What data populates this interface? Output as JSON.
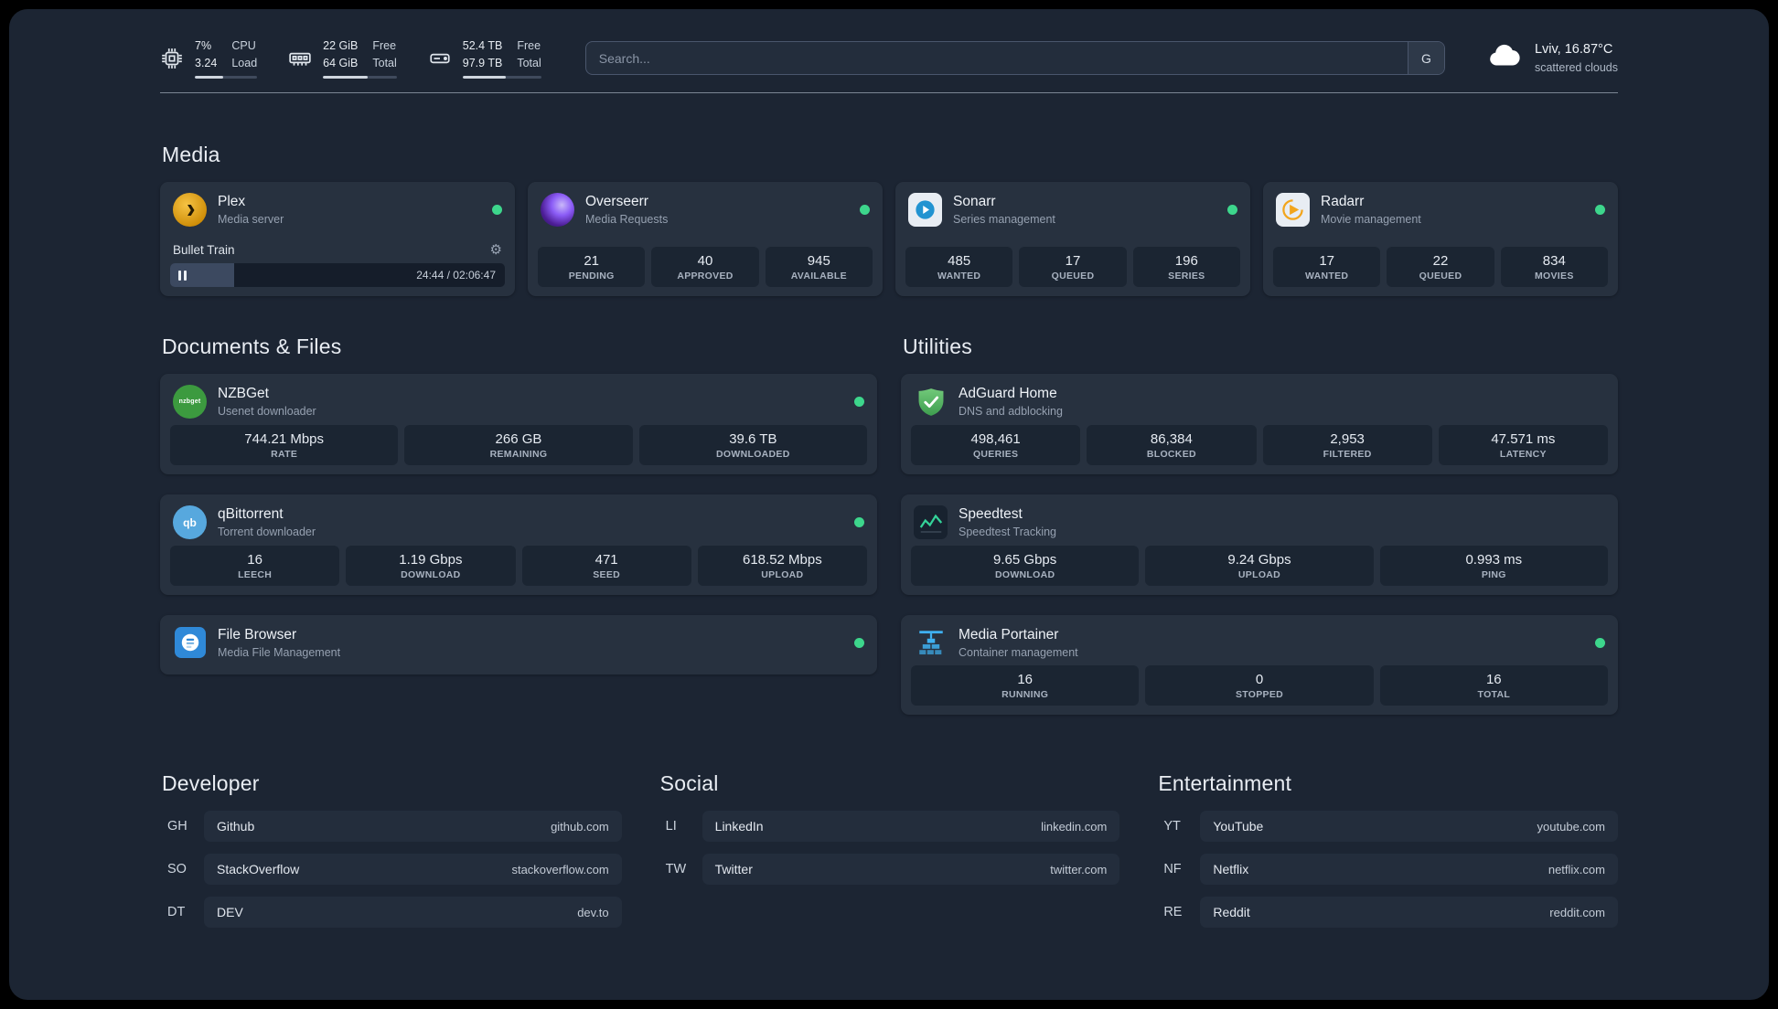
{
  "theme": {
    "background": "#1c2533",
    "card": "#27313f",
    "stat_block": "#1b2532",
    "status_ok": "#3dd68c",
    "text_primary": "#eef2f7",
    "text_secondary": "#96a1b1"
  },
  "topbar": {
    "cpu": {
      "value_top": "7%",
      "value_bottom": "3.24",
      "label_top": "CPU",
      "label_bottom": "Load",
      "bar_percent": 45
    },
    "memory": {
      "value_top": "22 GiB",
      "value_bottom": "64 GiB",
      "label_top": "Free",
      "label_bottom": "Total",
      "bar_percent": 60
    },
    "disk": {
      "value_top": "52.4 TB",
      "value_bottom": "97.9 TB",
      "label_top": "Free",
      "label_bottom": "Total",
      "bar_percent": 55
    },
    "search": {
      "placeholder": "Search...",
      "button_label": "G"
    },
    "weather": {
      "location": "Lviv, 16.87°C",
      "condition": "scattered clouds"
    }
  },
  "groups": [
    {
      "title": "Media",
      "services": [
        {
          "name": "Plex",
          "subtitle": "Media server",
          "icon": "plex",
          "status": true,
          "player": {
            "track": "Bullet Train",
            "time": "24:44 / 02:06:47",
            "progress_percent": 19
          }
        },
        {
          "name": "Overseerr",
          "subtitle": "Media Requests",
          "icon": "overseerr",
          "status": true,
          "stats": [
            {
              "value": "21",
              "label": "PENDING"
            },
            {
              "value": "40",
              "label": "APPROVED"
            },
            {
              "value": "945",
              "label": "AVAILABLE"
            }
          ]
        },
        {
          "name": "Sonarr",
          "subtitle": "Series management",
          "icon": "sonarr",
          "status": true,
          "stats": [
            {
              "value": "485",
              "label": "WANTED"
            },
            {
              "value": "17",
              "label": "QUEUED"
            },
            {
              "value": "196",
              "label": "SERIES"
            }
          ]
        },
        {
          "name": "Radarr",
          "subtitle": "Movie management",
          "icon": "radarr",
          "status": true,
          "stats": [
            {
              "value": "17",
              "label": "WANTED"
            },
            {
              "value": "22",
              "label": "QUEUED"
            },
            {
              "value": "834",
              "label": "MOVIES"
            }
          ]
        }
      ]
    },
    {
      "title": "Documents & Files",
      "services": [
        {
          "name": "NZBGet",
          "subtitle": "Usenet downloader",
          "icon": "nzbget",
          "status": true,
          "stats": [
            {
              "value": "744.21 Mbps",
              "label": "RATE"
            },
            {
              "value": "266 GB",
              "label": "REMAINING"
            },
            {
              "value": "39.6 TB",
              "label": "DOWNLOADED"
            }
          ]
        },
        {
          "name": "qBittorrent",
          "subtitle": "Torrent downloader",
          "icon": "qbittorrent",
          "status": true,
          "stats": [
            {
              "value": "16",
              "label": "LEECH"
            },
            {
              "value": "1.19 Gbps",
              "label": "DOWNLOAD"
            },
            {
              "value": "471",
              "label": "SEED"
            },
            {
              "value": "618.52 Mbps",
              "label": "UPLOAD"
            }
          ]
        },
        {
          "name": "File Browser",
          "subtitle": "Media File Management",
          "icon": "filebrowser",
          "status": true
        }
      ]
    },
    {
      "title": "Utilities",
      "services": [
        {
          "name": "AdGuard Home",
          "subtitle": "DNS and adblocking",
          "icon": "adguard",
          "stats": [
            {
              "value": "498,461",
              "label": "QUERIES"
            },
            {
              "value": "86,384",
              "label": "BLOCKED"
            },
            {
              "value": "2,953",
              "label": "FILTERED"
            },
            {
              "value": "47.571 ms",
              "label": "LATENCY"
            }
          ]
        },
        {
          "name": "Speedtest",
          "subtitle": "Speedtest Tracking",
          "icon": "speedtest",
          "stats": [
            {
              "value": "9.65 Gbps",
              "label": "DOWNLOAD"
            },
            {
              "value": "9.24 Gbps",
              "label": "UPLOAD"
            },
            {
              "value": "0.993 ms",
              "label": "PING"
            }
          ]
        },
        {
          "name": "Media Portainer",
          "subtitle": "Container management",
          "icon": "portainer",
          "status": true,
          "stats": [
            {
              "value": "16",
              "label": "RUNNING"
            },
            {
              "value": "0",
              "label": "STOPPED"
            },
            {
              "value": "16",
              "label": "TOTAL"
            }
          ]
        }
      ]
    }
  ],
  "bookmarks": [
    {
      "title": "Developer",
      "items": [
        {
          "abbr": "GH",
          "name": "Github",
          "url": "github.com"
        },
        {
          "abbr": "SO",
          "name": "StackOverflow",
          "url": "stackoverflow.com"
        },
        {
          "abbr": "DT",
          "name": "DEV",
          "url": "dev.to"
        }
      ]
    },
    {
      "title": "Social",
      "items": [
        {
          "abbr": "LI",
          "name": "LinkedIn",
          "url": "linkedin.com"
        },
        {
          "abbr": "TW",
          "name": "Twitter",
          "url": "twitter.com"
        }
      ]
    },
    {
      "title": "Entertainment",
      "items": [
        {
          "abbr": "YT",
          "name": "YouTube",
          "url": "youtube.com"
        },
        {
          "abbr": "NF",
          "name": "Netflix",
          "url": "netflix.com"
        },
        {
          "abbr": "RE",
          "name": "Reddit",
          "url": "reddit.com"
        }
      ]
    }
  ]
}
